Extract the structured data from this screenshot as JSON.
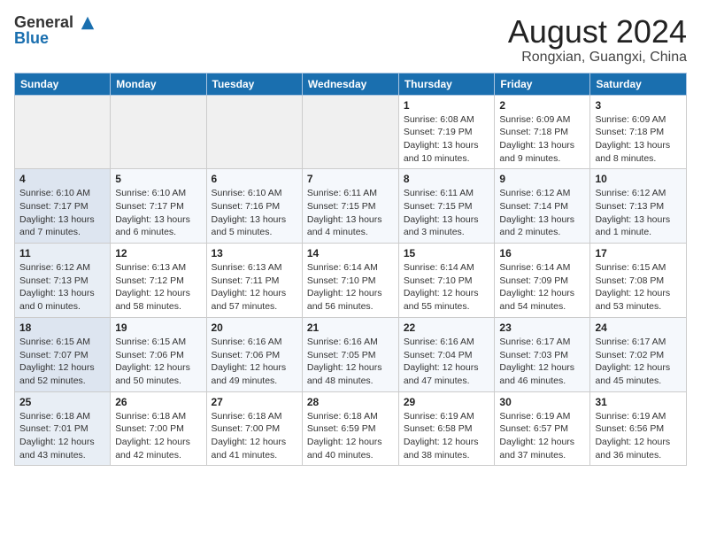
{
  "header": {
    "logo_line1": "General",
    "logo_line2": "Blue",
    "title": "August 2024",
    "subtitle": "Rongxian, Guangxi, China"
  },
  "weekdays": [
    "Sunday",
    "Monday",
    "Tuesday",
    "Wednesday",
    "Thursday",
    "Friday",
    "Saturday"
  ],
  "weeks": [
    [
      {
        "day": "",
        "info": ""
      },
      {
        "day": "",
        "info": ""
      },
      {
        "day": "",
        "info": ""
      },
      {
        "day": "",
        "info": ""
      },
      {
        "day": "1",
        "info": "Sunrise: 6:08 AM\nSunset: 7:19 PM\nDaylight: 13 hours\nand 10 minutes."
      },
      {
        "day": "2",
        "info": "Sunrise: 6:09 AM\nSunset: 7:18 PM\nDaylight: 13 hours\nand 9 minutes."
      },
      {
        "day": "3",
        "info": "Sunrise: 6:09 AM\nSunset: 7:18 PM\nDaylight: 13 hours\nand 8 minutes."
      }
    ],
    [
      {
        "day": "4",
        "info": "Sunrise: 6:10 AM\nSunset: 7:17 PM\nDaylight: 13 hours\nand 7 minutes."
      },
      {
        "day": "5",
        "info": "Sunrise: 6:10 AM\nSunset: 7:17 PM\nDaylight: 13 hours\nand 6 minutes."
      },
      {
        "day": "6",
        "info": "Sunrise: 6:10 AM\nSunset: 7:16 PM\nDaylight: 13 hours\nand 5 minutes."
      },
      {
        "day": "7",
        "info": "Sunrise: 6:11 AM\nSunset: 7:15 PM\nDaylight: 13 hours\nand 4 minutes."
      },
      {
        "day": "8",
        "info": "Sunrise: 6:11 AM\nSunset: 7:15 PM\nDaylight: 13 hours\nand 3 minutes."
      },
      {
        "day": "9",
        "info": "Sunrise: 6:12 AM\nSunset: 7:14 PM\nDaylight: 13 hours\nand 2 minutes."
      },
      {
        "day": "10",
        "info": "Sunrise: 6:12 AM\nSunset: 7:13 PM\nDaylight: 13 hours\nand 1 minute."
      }
    ],
    [
      {
        "day": "11",
        "info": "Sunrise: 6:12 AM\nSunset: 7:13 PM\nDaylight: 13 hours\nand 0 minutes."
      },
      {
        "day": "12",
        "info": "Sunrise: 6:13 AM\nSunset: 7:12 PM\nDaylight: 12 hours\nand 58 minutes."
      },
      {
        "day": "13",
        "info": "Sunrise: 6:13 AM\nSunset: 7:11 PM\nDaylight: 12 hours\nand 57 minutes."
      },
      {
        "day": "14",
        "info": "Sunrise: 6:14 AM\nSunset: 7:10 PM\nDaylight: 12 hours\nand 56 minutes."
      },
      {
        "day": "15",
        "info": "Sunrise: 6:14 AM\nSunset: 7:10 PM\nDaylight: 12 hours\nand 55 minutes."
      },
      {
        "day": "16",
        "info": "Sunrise: 6:14 AM\nSunset: 7:09 PM\nDaylight: 12 hours\nand 54 minutes."
      },
      {
        "day": "17",
        "info": "Sunrise: 6:15 AM\nSunset: 7:08 PM\nDaylight: 12 hours\nand 53 minutes."
      }
    ],
    [
      {
        "day": "18",
        "info": "Sunrise: 6:15 AM\nSunset: 7:07 PM\nDaylight: 12 hours\nand 52 minutes."
      },
      {
        "day": "19",
        "info": "Sunrise: 6:15 AM\nSunset: 7:06 PM\nDaylight: 12 hours\nand 50 minutes."
      },
      {
        "day": "20",
        "info": "Sunrise: 6:16 AM\nSunset: 7:06 PM\nDaylight: 12 hours\nand 49 minutes."
      },
      {
        "day": "21",
        "info": "Sunrise: 6:16 AM\nSunset: 7:05 PM\nDaylight: 12 hours\nand 48 minutes."
      },
      {
        "day": "22",
        "info": "Sunrise: 6:16 AM\nSunset: 7:04 PM\nDaylight: 12 hours\nand 47 minutes."
      },
      {
        "day": "23",
        "info": "Sunrise: 6:17 AM\nSunset: 7:03 PM\nDaylight: 12 hours\nand 46 minutes."
      },
      {
        "day": "24",
        "info": "Sunrise: 6:17 AM\nSunset: 7:02 PM\nDaylight: 12 hours\nand 45 minutes."
      }
    ],
    [
      {
        "day": "25",
        "info": "Sunrise: 6:18 AM\nSunset: 7:01 PM\nDaylight: 12 hours\nand 43 minutes."
      },
      {
        "day": "26",
        "info": "Sunrise: 6:18 AM\nSunset: 7:00 PM\nDaylight: 12 hours\nand 42 minutes."
      },
      {
        "day": "27",
        "info": "Sunrise: 6:18 AM\nSunset: 7:00 PM\nDaylight: 12 hours\nand 41 minutes."
      },
      {
        "day": "28",
        "info": "Sunrise: 6:18 AM\nSunset: 6:59 PM\nDaylight: 12 hours\nand 40 minutes."
      },
      {
        "day": "29",
        "info": "Sunrise: 6:19 AM\nSunset: 6:58 PM\nDaylight: 12 hours\nand 38 minutes."
      },
      {
        "day": "30",
        "info": "Sunrise: 6:19 AM\nSunset: 6:57 PM\nDaylight: 12 hours\nand 37 minutes."
      },
      {
        "day": "31",
        "info": "Sunrise: 6:19 AM\nSunset: 6:56 PM\nDaylight: 12 hours\nand 36 minutes."
      }
    ]
  ]
}
